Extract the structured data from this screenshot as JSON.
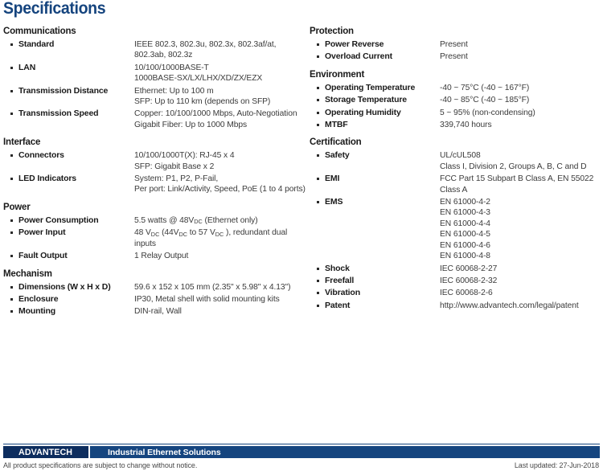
{
  "title": "Specifications",
  "left_column": [
    {
      "group": "Communications",
      "rows": [
        {
          "label": "Standard",
          "value": "IEEE 802.3, 802.3u, 802.3x, 802.3af/at,\n802.3ab, 802.3z"
        },
        {
          "label": "LAN",
          "value": "10/100/1000BASE-T\n1000BASE-SX/LX/LHX/XD/ZX/EZX"
        },
        {
          "label": "Transmission Distance",
          "value": "Ethernet: Up to 100 m\nSFP: Up to 110 km (depends on SFP)"
        },
        {
          "label": "Transmission Speed",
          "value": "Copper: 10/100/1000 Mbps, Auto-Negotiation\nGigabit Fiber: Up to 1000 Mbps"
        }
      ]
    },
    {
      "group": "Interface",
      "rows": [
        {
          "label": "Connectors",
          "value": "10/100/1000T(X): RJ-45 x 4\nSFP: Gigabit Base x 2"
        },
        {
          "label": "LED Indicators",
          "value": "System: P1, P2, P-Fail,\nPer port: Link/Activity, Speed, PoE (1 to 4 ports)"
        }
      ]
    },
    {
      "group": "Power",
      "rows": [
        {
          "label": "Power Consumption",
          "value": "5.5 watts @ 48V<sub>DC</sub>  (Ethernet only)",
          "html": true
        },
        {
          "label": "Power Input",
          "value": "48 V<sub>DC</sub> (44V<sub>DC</sub> to 57 V<sub>DC</sub> ), redundant dual inputs",
          "html": true
        },
        {
          "label": "Fault Output",
          "value": "1 Relay Output"
        }
      ]
    },
    {
      "group": "Mechanism",
      "rows": [
        {
          "label": "Dimensions (W x H x D)",
          "value": "59.6 x 152 x 105 mm (2.35\" x 5.98\" x 4.13\")"
        },
        {
          "label": "Enclosure",
          "value": "IP30, Metal shell with solid mounting kits"
        },
        {
          "label": "Mounting",
          "value": "DIN-rail, Wall"
        }
      ]
    }
  ],
  "right_column": [
    {
      "group": "Protection",
      "rows": [
        {
          "label": "Power Reverse",
          "value": "Present"
        },
        {
          "label": "Overload Current",
          "value": "Present"
        }
      ]
    },
    {
      "group": "Environment",
      "rows": [
        {
          "label": "Operating Temperature",
          "value": "-40 ~ 75°C  (-40 ~ 167°F)"
        },
        {
          "label": "Storage Temperature",
          "value": "-40 ~ 85°C  (-40 ~ 185°F)"
        },
        {
          "label": "Operating Humidity",
          "value": "5 ~ 95% (non-condensing)"
        },
        {
          "label": "MTBF",
          "value": "339,740 hours"
        }
      ]
    },
    {
      "group": "Certification",
      "rows": [
        {
          "label": "Safety",
          "value": "UL/cUL508\nClass I, Division 2, Groups A, B, C and D"
        },
        {
          "label": "EMI",
          "value": "FCC Part 15 Subpart B Class A,  EN 55022\nClass A"
        },
        {
          "label": "EMS",
          "value": "EN 61000-4-2\nEN 61000-4-3\nEN 61000-4-4\nEN 61000-4-5\nEN 61000-4-6\nEN 61000-4-8"
        },
        {
          "label": "Shock",
          "value": "IEC 60068-2-27"
        },
        {
          "label": "Freefall",
          "value": "IEC 60068-2-32"
        },
        {
          "label": "Vibration",
          "value": "IEC 60068-2-6"
        },
        {
          "label": "Patent",
          "value": "http://www.advantech.com/legal/patent"
        }
      ]
    }
  ],
  "footer": {
    "logo": "ADVANTECH",
    "banner": "Industrial Ethernet Solutions",
    "note": "All product specifications are subject to change without notice.",
    "updated": "Last updated: 27-Jun-2018"
  },
  "colors": {
    "title_blue": "#15447e",
    "logo_navy": "#0d2d5e",
    "banner_blue": "#15457f",
    "label_dark": "#1a1a1a",
    "value_gray": "#3b3b3b"
  }
}
